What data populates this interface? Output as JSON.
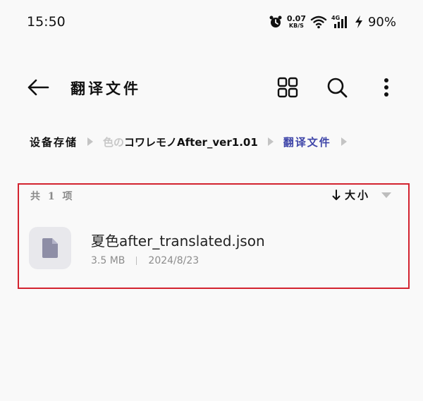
{
  "status_bar": {
    "time": "15:50",
    "net_speed_value": "0.07",
    "net_speed_unit": "KB/S",
    "network_type": "4G",
    "battery_percent": "90%"
  },
  "app_bar": {
    "title": "翻译文件"
  },
  "breadcrumb": {
    "root": "设备存储",
    "middle_faded": "色の",
    "middle": "コワレモノAfter_ver1.01",
    "current": "翻译文件"
  },
  "list": {
    "count_label": "共 1 项",
    "sort_label": "大小",
    "files": [
      {
        "name": "夏色after_translated.json",
        "size": "3.5 MB",
        "date": "2024/8/23",
        "icon": "document-icon"
      }
    ]
  },
  "colors": {
    "accent": "#3d44a8",
    "highlight_border": "#d3232f",
    "background": "#f9f9f9"
  }
}
